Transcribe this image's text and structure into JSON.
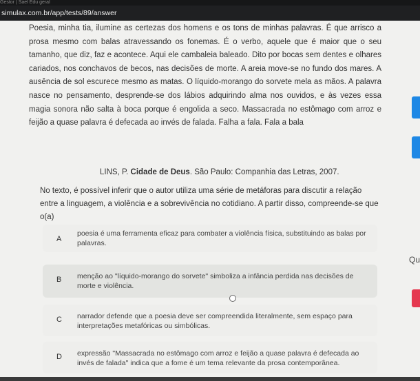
{
  "browser": {
    "tab_text": "Gestor | Sael Edu geral",
    "url": "simulax.com.br/app/tests/89/answer"
  },
  "passage": {
    "text": "Poesia, minha tia, ilumine as certezas dos homens e os tons de minhas palavras. É que arrisco a prosa mesmo com balas atravessando os fonemas. É o verbo, aquele que é maior que o seu tamanho, que diz, faz e acontece. Aqui ele cambaleia baleado. Dito por bocas sem dentes e olhares cariados, nos conchavos de becos, nas decisões de morte. A areia move-se no fundo dos mares. A ausência de sol escurece mesmo as matas. O líquido-morango do sorvete mela as mãos. A palavra nasce no pensamento, desprende-se dos lábios adquirindo alma nos ouvidos, e às vezes essa magia sonora não salta à boca porque é engolida a seco. Massacrada no estômago com arroz e feijão a quase palavra é defecada ao invés de falada. Falha a fala. Fala a bala",
    "citation_author": "LINS, P.",
    "citation_title": "Cidade de Deus",
    "citation_rest": ". São Paulo: Companhia das Letras, 2007."
  },
  "question": "No texto, é possível inferir que o autor utiliza uma série de metáforas para discutir a relação entre a linguagem, a violência e a sobrevivência no cotidiano. A partir disso, compreende-se que o(a)",
  "options": [
    {
      "letter": "A",
      "text": "poesia é uma ferramenta eficaz para combater a violência física, substituindo as balas por palavras."
    },
    {
      "letter": "B",
      "text": "menção ao \"líquido-morango do sorvete\" simboliza a infância perdida nas decisões de morte e violência."
    },
    {
      "letter": "C",
      "text": "narrador defende que a poesia deve ser compreendida literalmente, sem espaço para interpretações metafóricas ou simbólicas."
    },
    {
      "letter": "D",
      "text": "expressão \"Massacrada no estômago com arroz e feijão a quase palavra é defecada ao invés de falada\" indica que a fome é um tema relevante da prosa contemporânea."
    }
  ],
  "side": {
    "question_label": "Qu"
  },
  "colors": {
    "accent_blue": "#1e88e5",
    "accent_red": "#e53950"
  }
}
